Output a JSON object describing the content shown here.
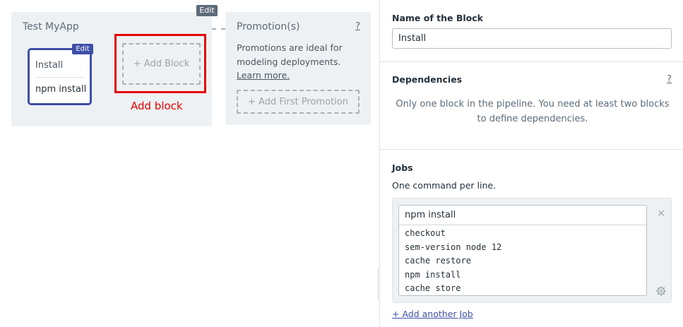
{
  "canvas": {
    "pipeline": {
      "title": "Test MyApp",
      "edit_label": "Edit",
      "block": {
        "name": "Install",
        "edit_label": "Edit",
        "job": "npm install"
      },
      "add_block_label": "+ Add Block",
      "add_block_caption": "Add block"
    },
    "promotions": {
      "title": "Promotion(s)",
      "help": "?",
      "description": "Promotions are ideal for modeling deployments.",
      "learn_more": "Learn more.",
      "add_first_label": "+ Add First Promotion"
    }
  },
  "panel": {
    "block_name": {
      "label": "Name of the Block",
      "value": "Install"
    },
    "dependencies": {
      "label": "Dependencies",
      "help": "?",
      "message": "Only one block in the pipeline. You need at least two blocks to define dependencies."
    },
    "jobs": {
      "label": "Jobs",
      "hint": "One command per line.",
      "job": {
        "name": "npm install",
        "commands": [
          "checkout",
          "sem-version node 12",
          "cache restore",
          "npm install",
          "cache store"
        ],
        "close_icon": "×"
      },
      "add_job_label": "+ Add another Job"
    }
  },
  "colors": {
    "accent": "#3e4fa8",
    "highlight": "#e30000",
    "card_bg": "#eef1f3",
    "edit_badge": "#5d6b78"
  }
}
